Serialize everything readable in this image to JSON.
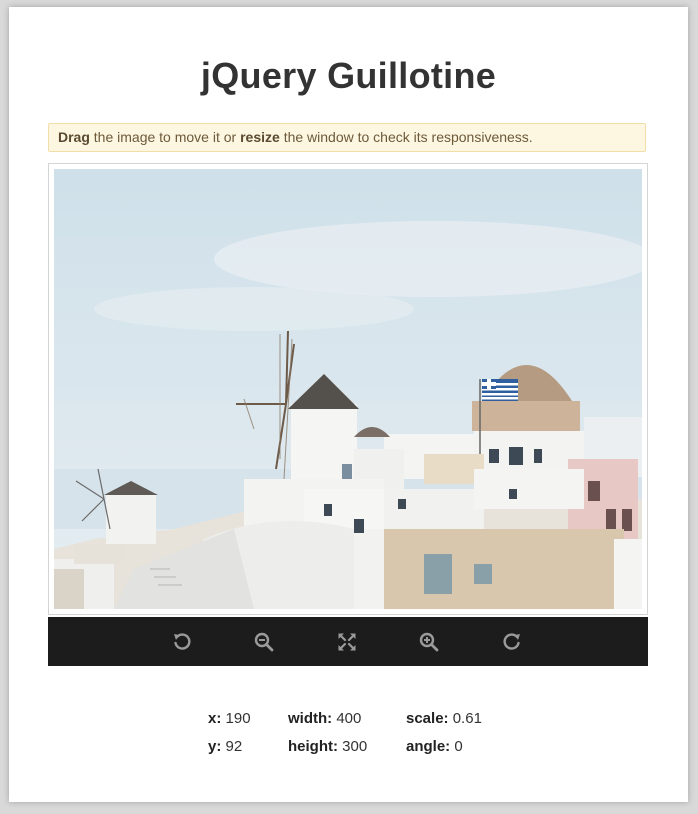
{
  "page": {
    "title": "jQuery Guillotine"
  },
  "notice": {
    "drag_word": "Drag",
    "text_middle": "the image to move it or",
    "resize_word": "resize",
    "text_end": "the window to check its responsiveness."
  },
  "toolbar": {
    "buttons": [
      {
        "name": "rotate-left-button",
        "icon": "rotate-left-icon"
      },
      {
        "name": "zoom-out-button",
        "icon": "zoom-out-icon"
      },
      {
        "name": "fit-button",
        "icon": "fit-icon"
      },
      {
        "name": "zoom-in-button",
        "icon": "zoom-in-icon"
      },
      {
        "name": "rotate-right-button",
        "icon": "rotate-right-icon"
      }
    ],
    "colors": {
      "background": "#1c1c1c",
      "icon": "#9a9a9a"
    }
  },
  "data_panel": {
    "x_label": "x:",
    "x_value": "190",
    "y_label": "y:",
    "y_value": "92",
    "width_label": "width:",
    "width_value": "400",
    "height_label": "height:",
    "height_value": "300",
    "scale_label": "scale:",
    "scale_value": "0.61",
    "angle_label": "angle:",
    "angle_value": "0"
  }
}
